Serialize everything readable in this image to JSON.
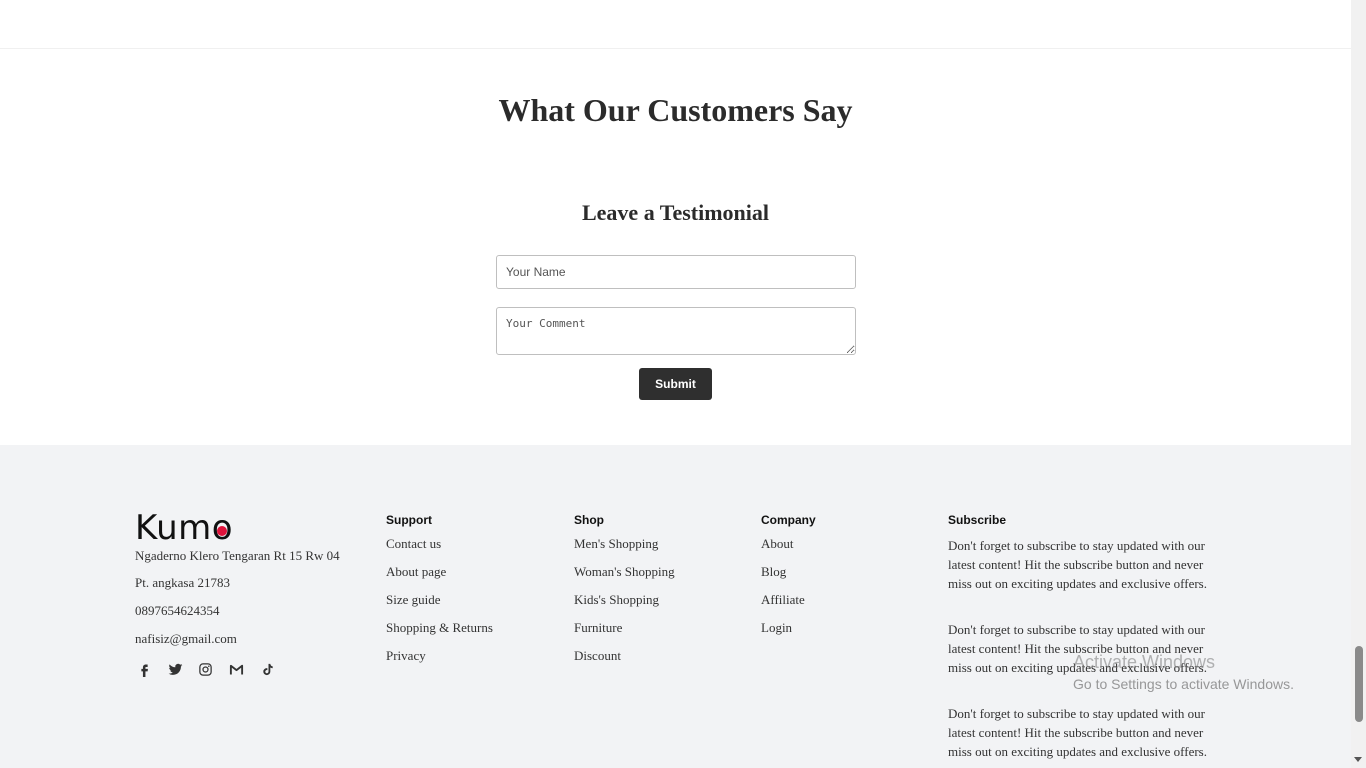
{
  "testimonials": {
    "heading": "What Our Customers Say",
    "form_heading": "Leave a Testimonial",
    "name_placeholder": "Your Name",
    "comment_placeholder": "Your Comment",
    "submit_label": "Submit"
  },
  "footer": {
    "brand": {
      "logo_text_before": "Kum",
      "logo_text_o": "o",
      "accent_color": "#e0143c"
    },
    "address_line1": "Ngaderno Klero Tengaran Rt 15 Rw 04",
    "address_line2": "Pt. angkasa 21783",
    "phone": "0897654624354",
    "email": "nafisiz@gmail.com",
    "social_icons": [
      "facebook-icon",
      "twitter-icon",
      "instagram-icon",
      "gmail-icon",
      "tiktok-icon"
    ],
    "support": {
      "title": "Support",
      "links": [
        "Contact us",
        "About page",
        "Size guide",
        "Shopping & Returns",
        "Privacy"
      ]
    },
    "shop": {
      "title": "Shop",
      "links": [
        "Men's Shopping",
        "Woman's Shopping",
        "Kids's Shopping",
        "Furniture",
        "Discount"
      ]
    },
    "company": {
      "title": "Company",
      "links": [
        "About",
        "Blog",
        "Affiliate",
        "Login"
      ]
    },
    "subscribe": {
      "title": "Subscribe",
      "paragraphs": [
        "Don't forget to subscribe to stay updated with our latest content! Hit the subscribe button and never miss out on exciting updates and exclusive offers.",
        "Don't forget to subscribe to stay updated with our latest content! Hit the subscribe button and never miss out on exciting updates and exclusive offers.",
        "Don't forget to subscribe to stay updated with our latest content! Hit the subscribe button and never miss out on exciting updates and exclusive offers."
      ]
    }
  },
  "watermark": {
    "line1": "Activate Windows",
    "line2": "Go to Settings to activate Windows."
  }
}
